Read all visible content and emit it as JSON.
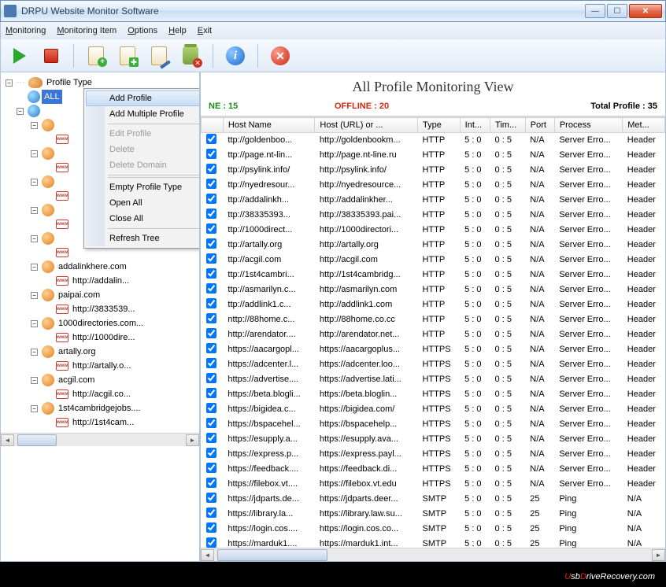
{
  "window": {
    "title": "DRPU Website Monitor Software"
  },
  "menubar": [
    "Monitoring",
    "Monitoring Item",
    "Options",
    "Help",
    "Exit"
  ],
  "tree": {
    "root": "Profile Type",
    "selected": "ALL",
    "domains": [
      {
        "name": "addalinkhere.com",
        "child": "http://addalin..."
      },
      {
        "name": "paipai.com",
        "child": "http://3833539..."
      },
      {
        "name": "1000directories.com...",
        "child": "http://1000dire..."
      },
      {
        "name": "artally.org",
        "child": "http://artally.o..."
      },
      {
        "name": "acgil.com",
        "child": "http://acgil.co..."
      },
      {
        "name": "1st4cambridgejobs....",
        "child": "http://1st4cam..."
      }
    ]
  },
  "context_menu": {
    "items": [
      {
        "label": "Add Profile",
        "state": "highlight"
      },
      {
        "label": "Add Multiple Profile",
        "state": "normal"
      },
      {
        "label": "Edit Profile",
        "state": "disabled"
      },
      {
        "label": "Delete",
        "state": "disabled"
      },
      {
        "label": "Delete Domain",
        "state": "disabled"
      },
      {
        "label": "Empty Profile Type",
        "state": "normal"
      },
      {
        "label": "Open All",
        "state": "normal"
      },
      {
        "label": "Close All",
        "state": "normal"
      },
      {
        "label": "Refresh Tree",
        "state": "normal"
      }
    ]
  },
  "view": {
    "title": "All Profile Monitoring View",
    "online_label": "NE : 15",
    "offline_label": "OFFLINE : 20",
    "total_label": "Total Profile : 35"
  },
  "columns": [
    "",
    "Host Name",
    "Host (URL) or ...",
    "Type",
    "Int...",
    "Tim...",
    "Port",
    "Process",
    "Met..."
  ],
  "rows": [
    {
      "host": "ttp://goldenboo...",
      "url": "http://goldenbookm...",
      "type": "HTTP",
      "int": "5 : 0",
      "tim": "0 : 5",
      "port": "N/A",
      "proc": "Server Erro...",
      "met": "Header"
    },
    {
      "host": "ttp://page.nt-lin...",
      "url": "http://page.nt-line.ru",
      "type": "HTTP",
      "int": "5 : 0",
      "tim": "0 : 5",
      "port": "N/A",
      "proc": "Server Erro...",
      "met": "Header"
    },
    {
      "host": "ttp://psylink.info/",
      "url": "http://psylink.info/",
      "type": "HTTP",
      "int": "5 : 0",
      "tim": "0 : 5",
      "port": "N/A",
      "proc": "Server Erro...",
      "met": "Header"
    },
    {
      "host": "ttp://nyedresour...",
      "url": "http://nyedresource...",
      "type": "HTTP",
      "int": "5 : 0",
      "tim": "0 : 5",
      "port": "N/A",
      "proc": "Server Erro...",
      "met": "Header"
    },
    {
      "host": "ttp://addalinkh...",
      "url": "http://addalinkher...",
      "type": "HTTP",
      "int": "5 : 0",
      "tim": "0 : 5",
      "port": "N/A",
      "proc": "Server Erro...",
      "met": "Header"
    },
    {
      "host": "ttp://38335393...",
      "url": "http://38335393.pai...",
      "type": "HTTP",
      "int": "5 : 0",
      "tim": "0 : 5",
      "port": "N/A",
      "proc": "Server Erro...",
      "met": "Header"
    },
    {
      "host": "ttp://1000direct...",
      "url": "http://1000directori...",
      "type": "HTTP",
      "int": "5 : 0",
      "tim": "0 : 5",
      "port": "N/A",
      "proc": "Server Erro...",
      "met": "Header"
    },
    {
      "host": "ttp://artally.org",
      "url": "http://artally.org",
      "type": "HTTP",
      "int": "5 : 0",
      "tim": "0 : 5",
      "port": "N/A",
      "proc": "Server Erro...",
      "met": "Header"
    },
    {
      "host": "ttp://acgil.com",
      "url": "http://acgil.com",
      "type": "HTTP",
      "int": "5 : 0",
      "tim": "0 : 5",
      "port": "N/A",
      "proc": "Server Erro...",
      "met": "Header"
    },
    {
      "host": "ttp://1st4cambri...",
      "url": "http://1st4cambridg...",
      "type": "HTTP",
      "int": "5 : 0",
      "tim": "0 : 5",
      "port": "N/A",
      "proc": "Server Erro...",
      "met": "Header"
    },
    {
      "host": "ttp://asmarilyn.c...",
      "url": "http://asmarilyn.com",
      "type": "HTTP",
      "int": "5 : 0",
      "tim": "0 : 5",
      "port": "N/A",
      "proc": "Server Erro...",
      "met": "Header"
    },
    {
      "host": "ttp://addlink1.c...",
      "url": "http://addlink1.com",
      "type": "HTTP",
      "int": "5 : 0",
      "tim": "0 : 5",
      "port": "N/A",
      "proc": "Server Erro...",
      "met": "Header"
    },
    {
      "host": "nttp://88home.c...",
      "url": "http://88home.co.cc",
      "type": "HTTP",
      "int": "5 : 0",
      "tim": "0 : 5",
      "port": "N/A",
      "proc": "Server Erro...",
      "met": "Header"
    },
    {
      "host": "http://arendator....",
      "url": "http://arendator.net...",
      "type": "HTTP",
      "int": "5 : 0",
      "tim": "0 : 5",
      "port": "N/A",
      "proc": "Server Erro...",
      "met": "Header"
    },
    {
      "host": "https://aacargopl...",
      "url": "https://aacargoplus...",
      "type": "HTTPS",
      "int": "5 : 0",
      "tim": "0 : 5",
      "port": "N/A",
      "proc": "Server Erro...",
      "met": "Header"
    },
    {
      "host": "https://adcenter.l...",
      "url": "https://adcenter.loo...",
      "type": "HTTPS",
      "int": "5 : 0",
      "tim": "0 : 5",
      "port": "N/A",
      "proc": "Server Erro...",
      "met": "Header"
    },
    {
      "host": "https://advertise....",
      "url": "https://advertise.lati...",
      "type": "HTTPS",
      "int": "5 : 0",
      "tim": "0 : 5",
      "port": "N/A",
      "proc": "Server Erro...",
      "met": "Header"
    },
    {
      "host": "https://beta.blogli...",
      "url": "https://beta.bloglin...",
      "type": "HTTPS",
      "int": "5 : 0",
      "tim": "0 : 5",
      "port": "N/A",
      "proc": "Server Erro...",
      "met": "Header"
    },
    {
      "host": "https://bigidea.c...",
      "url": "https://bigidea.com/",
      "type": "HTTPS",
      "int": "5 : 0",
      "tim": "0 : 5",
      "port": "N/A",
      "proc": "Server Erro...",
      "met": "Header"
    },
    {
      "host": "https://bspacehel...",
      "url": "https://bspacehelp...",
      "type": "HTTPS",
      "int": "5 : 0",
      "tim": "0 : 5",
      "port": "N/A",
      "proc": "Server Erro...",
      "met": "Header"
    },
    {
      "host": "https://esupply.a...",
      "url": "https://esupply.ava...",
      "type": "HTTPS",
      "int": "5 : 0",
      "tim": "0 : 5",
      "port": "N/A",
      "proc": "Server Erro...",
      "met": "Header"
    },
    {
      "host": "https://express.p...",
      "url": "https://express.payl...",
      "type": "HTTPS",
      "int": "5 : 0",
      "tim": "0 : 5",
      "port": "N/A",
      "proc": "Server Erro...",
      "met": "Header"
    },
    {
      "host": "https://feedback....",
      "url": "https://feedback.di...",
      "type": "HTTPS",
      "int": "5 : 0",
      "tim": "0 : 5",
      "port": "N/A",
      "proc": "Server Erro...",
      "met": "Header"
    },
    {
      "host": "https://filebox.vt....",
      "url": "https://filebox.vt.edu",
      "type": "HTTPS",
      "int": "5 : 0",
      "tim": "0 : 5",
      "port": "N/A",
      "proc": "Server Erro...",
      "met": "Header"
    },
    {
      "host": "https://jdparts.de...",
      "url": "https://jdparts.deer...",
      "type": "SMTP",
      "int": "5 : 0",
      "tim": "0 : 5",
      "port": "25",
      "proc": "Ping",
      "met": "N/A"
    },
    {
      "host": "https://library.la...",
      "url": "https://library.law.su...",
      "type": "SMTP",
      "int": "5 : 0",
      "tim": "0 : 5",
      "port": "25",
      "proc": "Ping",
      "met": "N/A"
    },
    {
      "host": "https://login.cos....",
      "url": "https://login.cos.co...",
      "type": "SMTP",
      "int": "5 : 0",
      "tim": "0 : 5",
      "port": "25",
      "proc": "Ping",
      "met": "N/A"
    },
    {
      "host": "https://marduk1....",
      "url": "https://marduk1.int...",
      "type": "SMTP",
      "int": "5 : 0",
      "tim": "0 : 5",
      "port": "25",
      "proc": "Ping",
      "met": "N/A"
    }
  ],
  "footer": {
    "brand_pre": "U",
    "brand_mid": "sb",
    "brand_d": "D",
    "brand_rest": "riveRecovery",
    "brand_tld": ".com"
  }
}
